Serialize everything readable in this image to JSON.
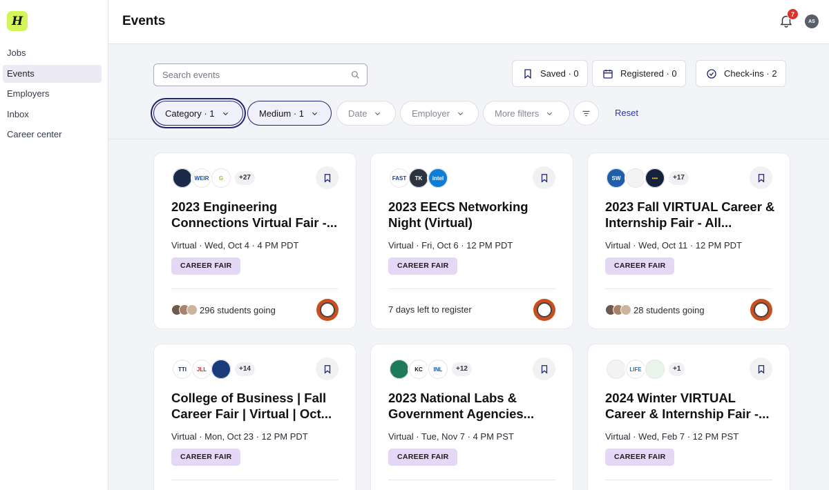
{
  "app": {
    "logo_letter": "H"
  },
  "sidebar": {
    "items": [
      {
        "label": "Jobs",
        "active": false
      },
      {
        "label": "Events",
        "active": true
      },
      {
        "label": "Employers",
        "active": false
      },
      {
        "label": "Inbox",
        "active": false
      },
      {
        "label": "Career center",
        "active": false
      }
    ]
  },
  "header": {
    "title": "Events",
    "notifications_count": "7",
    "user_initials": "AS"
  },
  "search": {
    "placeholder": "Search events",
    "value": ""
  },
  "stats": {
    "saved": "Saved · 0",
    "registered": "Registered · 0",
    "checkins": "Check-ins · 2"
  },
  "filters": {
    "category": "Category · 1",
    "medium": "Medium · 1",
    "date": "Date",
    "employer": "Employer",
    "more": "More filters",
    "reset": "Reset"
  },
  "colors": {
    "accent": "#1f2370",
    "link": "#2434c9",
    "tag_bg": "#e5d8f7",
    "logo_bg": "#d4f45b",
    "badge": "#d9332b"
  },
  "cards": [
    {
      "logos": [
        {
          "text": "",
          "bg": "#1c2a4a",
          "fg": "#fff"
        },
        {
          "text": "WEIR",
          "bg": "#fff",
          "fg": "#1b4fa8"
        },
        {
          "text": "G",
          "bg": "#fff",
          "fg": "#8cc63f"
        }
      ],
      "more": "+27",
      "title": "2023 Engineering Connections Virtual Fair -...",
      "meta": "Virtual · Wed, Oct 4 · 4 PM PDT",
      "tag": "CAREER FAIR",
      "footer": "296 students going",
      "show_attendees": true
    },
    {
      "logos": [
        {
          "text": "FAST",
          "bg": "#fff",
          "fg": "#1c3f8c"
        },
        {
          "text": "TK",
          "bg": "#2c3440",
          "fg": "#fff"
        },
        {
          "text": "intel",
          "bg": "#0f7dd6",
          "fg": "#fff"
        }
      ],
      "more": "",
      "title": "2023 EECS Networking Night (Virtual)",
      "meta": "Virtual · Fri, Oct 6 · 12 PM PDT",
      "tag": "CAREER FAIR",
      "footer": "7 days left to register",
      "show_attendees": false
    },
    {
      "logos": [
        {
          "text": "SW",
          "bg": "#1f5ea8",
          "fg": "#fff"
        },
        {
          "text": "",
          "bg": "#f3f3f3",
          "fg": "#333"
        },
        {
          "text": "•••",
          "bg": "#14223e",
          "fg": "#f2c12e"
        }
      ],
      "more": "+17",
      "title": "2023 Fall VIRTUAL Career & Internship Fair - All...",
      "meta": "Virtual · Wed, Oct 11 · 12 PM PDT",
      "tag": "CAREER FAIR",
      "footer": "28 students going",
      "show_attendees": true
    },
    {
      "logos": [
        {
          "text": "TTI",
          "bg": "#fff",
          "fg": "#1b2448"
        },
        {
          "text": "JLL",
          "bg": "#fff",
          "fg": "#d12d2d"
        },
        {
          "text": "",
          "bg": "#1b3a7a",
          "fg": "#fff"
        }
      ],
      "more": "+14",
      "title": "College of Business | Fall Career Fair | Virtual | Oct...",
      "meta": "Virtual · Mon, Oct 23 · 12 PM PDT",
      "tag": "CAREER FAIR",
      "footer": "",
      "show_attendees": false
    },
    {
      "logos": [
        {
          "text": "",
          "bg": "#1d7a5b",
          "fg": "#fff"
        },
        {
          "text": "KC",
          "bg": "#fff",
          "fg": "#111"
        },
        {
          "text": "INL",
          "bg": "#fff",
          "fg": "#1b4fa8"
        }
      ],
      "more": "+12",
      "title": "2023 National Labs & Government Agencies...",
      "meta": "Virtual · Tue, Nov 7 · 4 PM PST",
      "tag": "CAREER FAIR",
      "footer": "",
      "show_attendees": false
    },
    {
      "logos": [
        {
          "text": "",
          "bg": "#f3f3f3",
          "fg": "#333"
        },
        {
          "text": "LIFE",
          "bg": "#fff",
          "fg": "#2f6fa8"
        },
        {
          "text": "",
          "bg": "#eaf5ea",
          "fg": "#3c8c3c"
        }
      ],
      "more": "+1",
      "title": "2024 Winter VIRTUAL Career & Internship Fair -...",
      "meta": "Virtual · Wed, Feb 7 · 12 PM PST",
      "tag": "CAREER FAIR",
      "footer": "",
      "show_attendees": false
    }
  ]
}
